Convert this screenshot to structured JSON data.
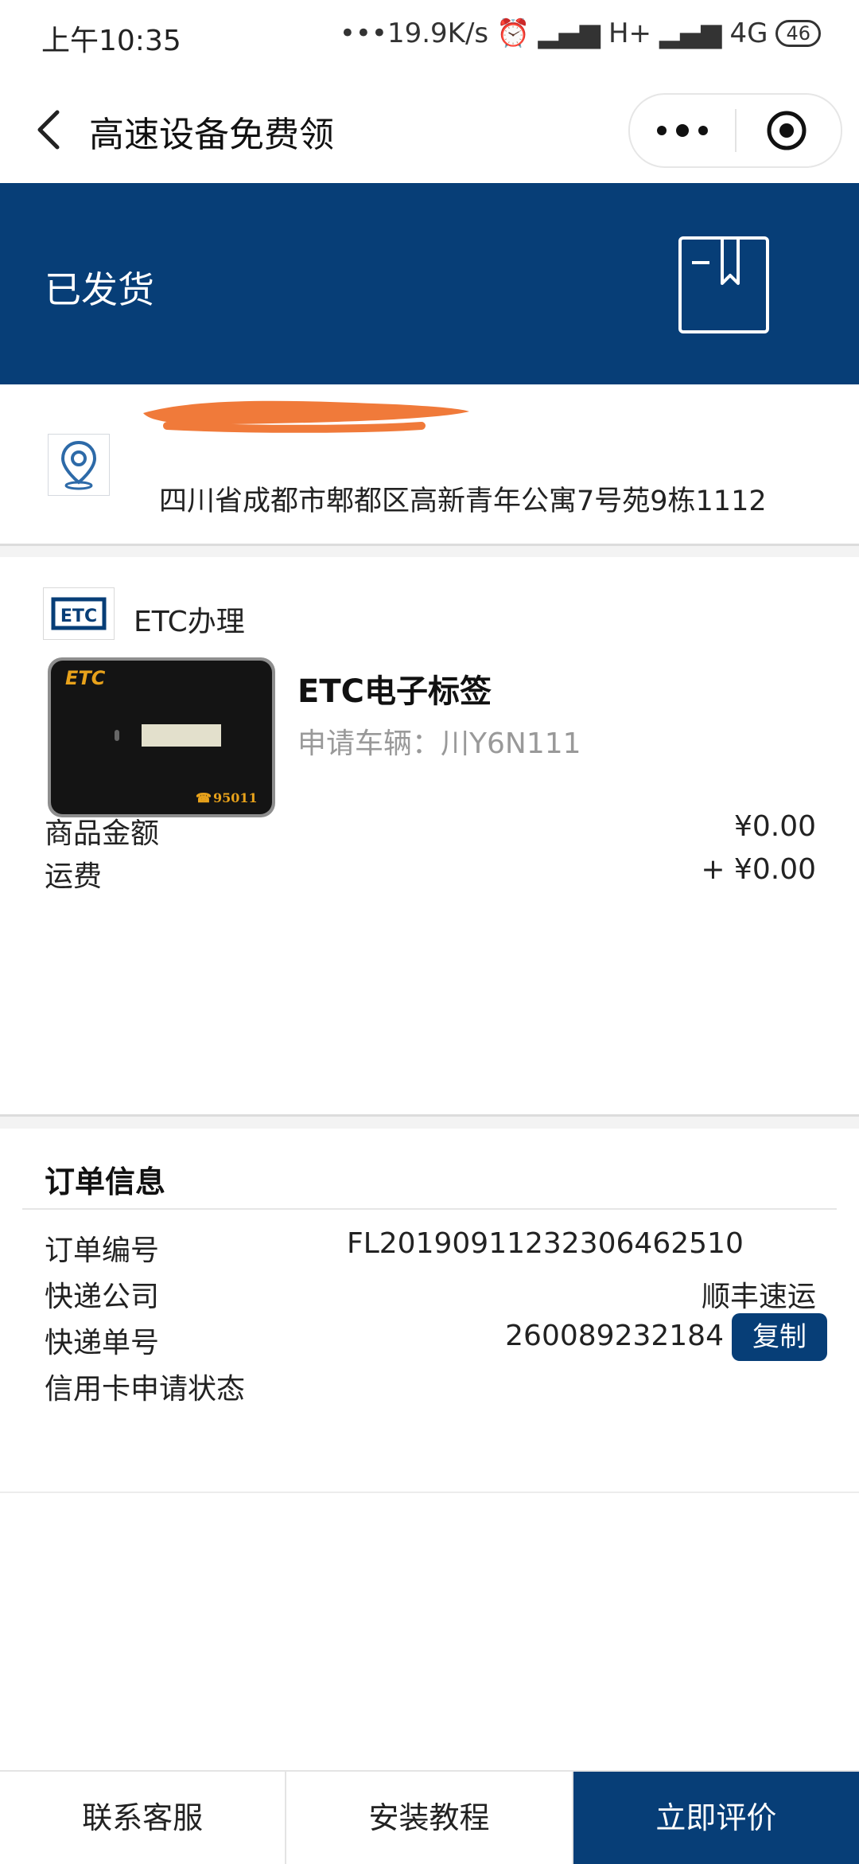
{
  "status_bar": {
    "time": "上午10:35",
    "net_speed": "•••19.9K/s",
    "network_1": "H+",
    "network_2": "4G",
    "battery": "46"
  },
  "header": {
    "title": "高速设备免费领"
  },
  "banner": {
    "status": "已发货",
    "bg_color": "#073e77"
  },
  "address": {
    "text": "四川省成都市郫都区高新青年公寓7号苑9栋1112"
  },
  "product": {
    "store_name": "ETC办理",
    "logo_text": "ETC",
    "name": "ETC电子标签",
    "vehicle_label": "申请车辆：",
    "vehicle_value": "川Y6N111",
    "img_brand": "ETC",
    "img_phone": "95011",
    "amount_label": "商品金额",
    "amount_value": "¥0.00",
    "shipping_label": "运费",
    "shipping_value": "+ ¥0.00"
  },
  "order": {
    "title": "订单信息",
    "order_no_label": "订单编号",
    "order_no": "FL20190911232306462510",
    "courier_label": "快递公司",
    "courier": "顺丰速运",
    "tracking_label": "快递单号",
    "tracking_no": "260089232184",
    "copy_label": "复制",
    "credit_label": "信用卡申请状态"
  },
  "bottom_bar": {
    "service": "联系客服",
    "tutorial": "安装教程",
    "review": "立即评价"
  }
}
